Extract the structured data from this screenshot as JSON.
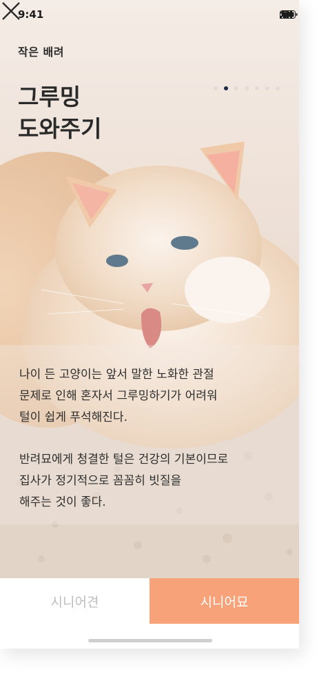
{
  "status_bar": {
    "time": "9:41",
    "icons": [
      "signal-icon",
      "wifi-icon",
      "battery-icon"
    ]
  },
  "header": {
    "title": "작은 배려",
    "close_icon": "close-icon"
  },
  "carousel": {
    "total": 7,
    "active_index": 1
  },
  "content": {
    "title_line1": "그루밍",
    "title_line2": "도와주기",
    "para1_line1": "나이 든 고양이는 앞서 말한 노화한 관절",
    "para1_line2": "문제로 인해 혼자서 그루밍하기가 어려워",
    "para1_line3": "털이 쉽게 푸석해진다.",
    "para2_line1": "반려묘에게 청결한 털은 건강의 기본이므로",
    "para2_line2": "집사가 정기적으로 꼼꼼히 빗질을",
    "para2_line3": "해주는 것이 좋다."
  },
  "bottom_tabs": {
    "left_label": "시니어견",
    "right_label": "시니어묘"
  },
  "colors": {
    "accent": "#f8a27a",
    "dot_active": "#1e2a4a",
    "text": "#2a2a2a",
    "inactive_tab": "#bdbdbd"
  }
}
